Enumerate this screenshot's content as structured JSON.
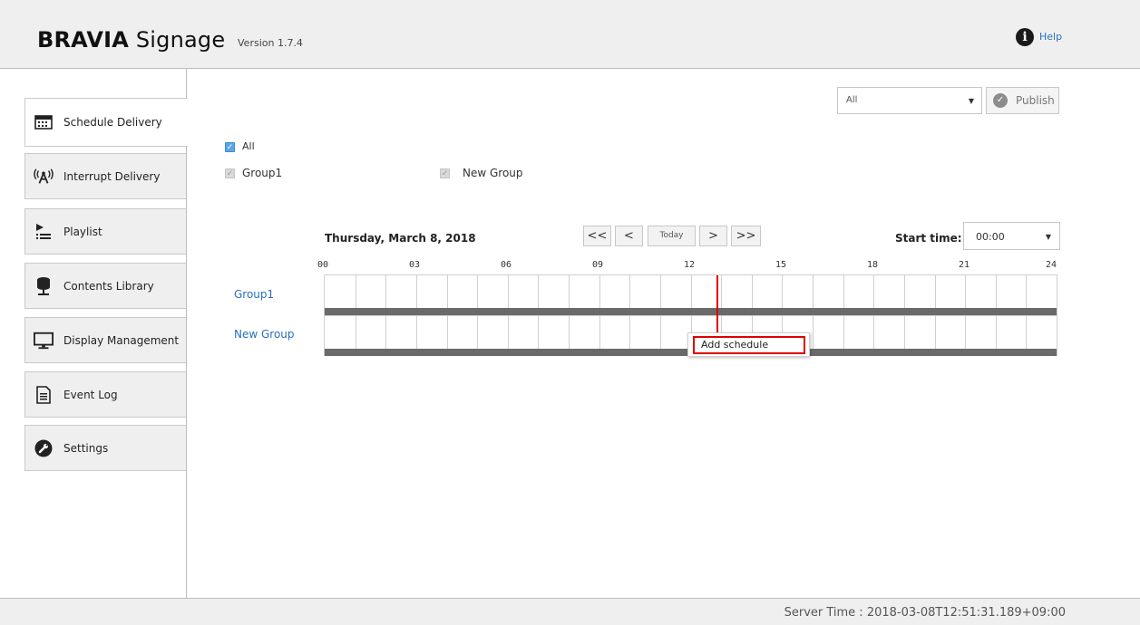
{
  "header": {
    "brand_bold": "BRAVIA",
    "brand_light": " Signage",
    "version": "Version 1.7.4",
    "help": "Help"
  },
  "sidebar": {
    "items": [
      {
        "label": "Schedule Delivery",
        "icon": "calendar-icon",
        "active": true
      },
      {
        "label": "Interrupt Delivery",
        "icon": "broadcast-icon",
        "active": false
      },
      {
        "label": "Playlist",
        "icon": "playlist-icon",
        "active": false
      },
      {
        "label": "Contents Library",
        "icon": "contents-library-icon",
        "active": false
      },
      {
        "label": "Display Management",
        "icon": "monitor-icon",
        "active": false
      },
      {
        "label": "Event Log",
        "icon": "document-icon",
        "active": false
      },
      {
        "label": "Settings",
        "icon": "wrench-icon",
        "active": false
      }
    ]
  },
  "toolbar": {
    "group_select_value": "All",
    "publish_label": "Publish"
  },
  "filters": {
    "all_label": "All",
    "all_checked": true,
    "groups": [
      {
        "label": "Group1",
        "checked": true,
        "disabled": true
      },
      {
        "label": "New Group",
        "checked": true,
        "disabled": true
      }
    ]
  },
  "schedule": {
    "date": "Thursday, March 8, 2018",
    "nav": {
      "first": "<<",
      "prev": "<",
      "today": "Today",
      "next": ">",
      "last": ">>"
    },
    "start_time_label": "Start time:",
    "start_time_value": "00:00",
    "hour_labels": [
      "00",
      "03",
      "06",
      "09",
      "12",
      "15",
      "18",
      "21",
      "24"
    ],
    "rows": [
      "Group1",
      "New Group"
    ],
    "context_menu": [
      "Add schedule"
    ]
  },
  "footer": {
    "server_time": "Server Time : 2018-03-08T12:51:31.189+09:00"
  },
  "colors": {
    "accent": "#2a6fbf",
    "highlight": "#e00000",
    "band": "#6a6a6a"
  }
}
